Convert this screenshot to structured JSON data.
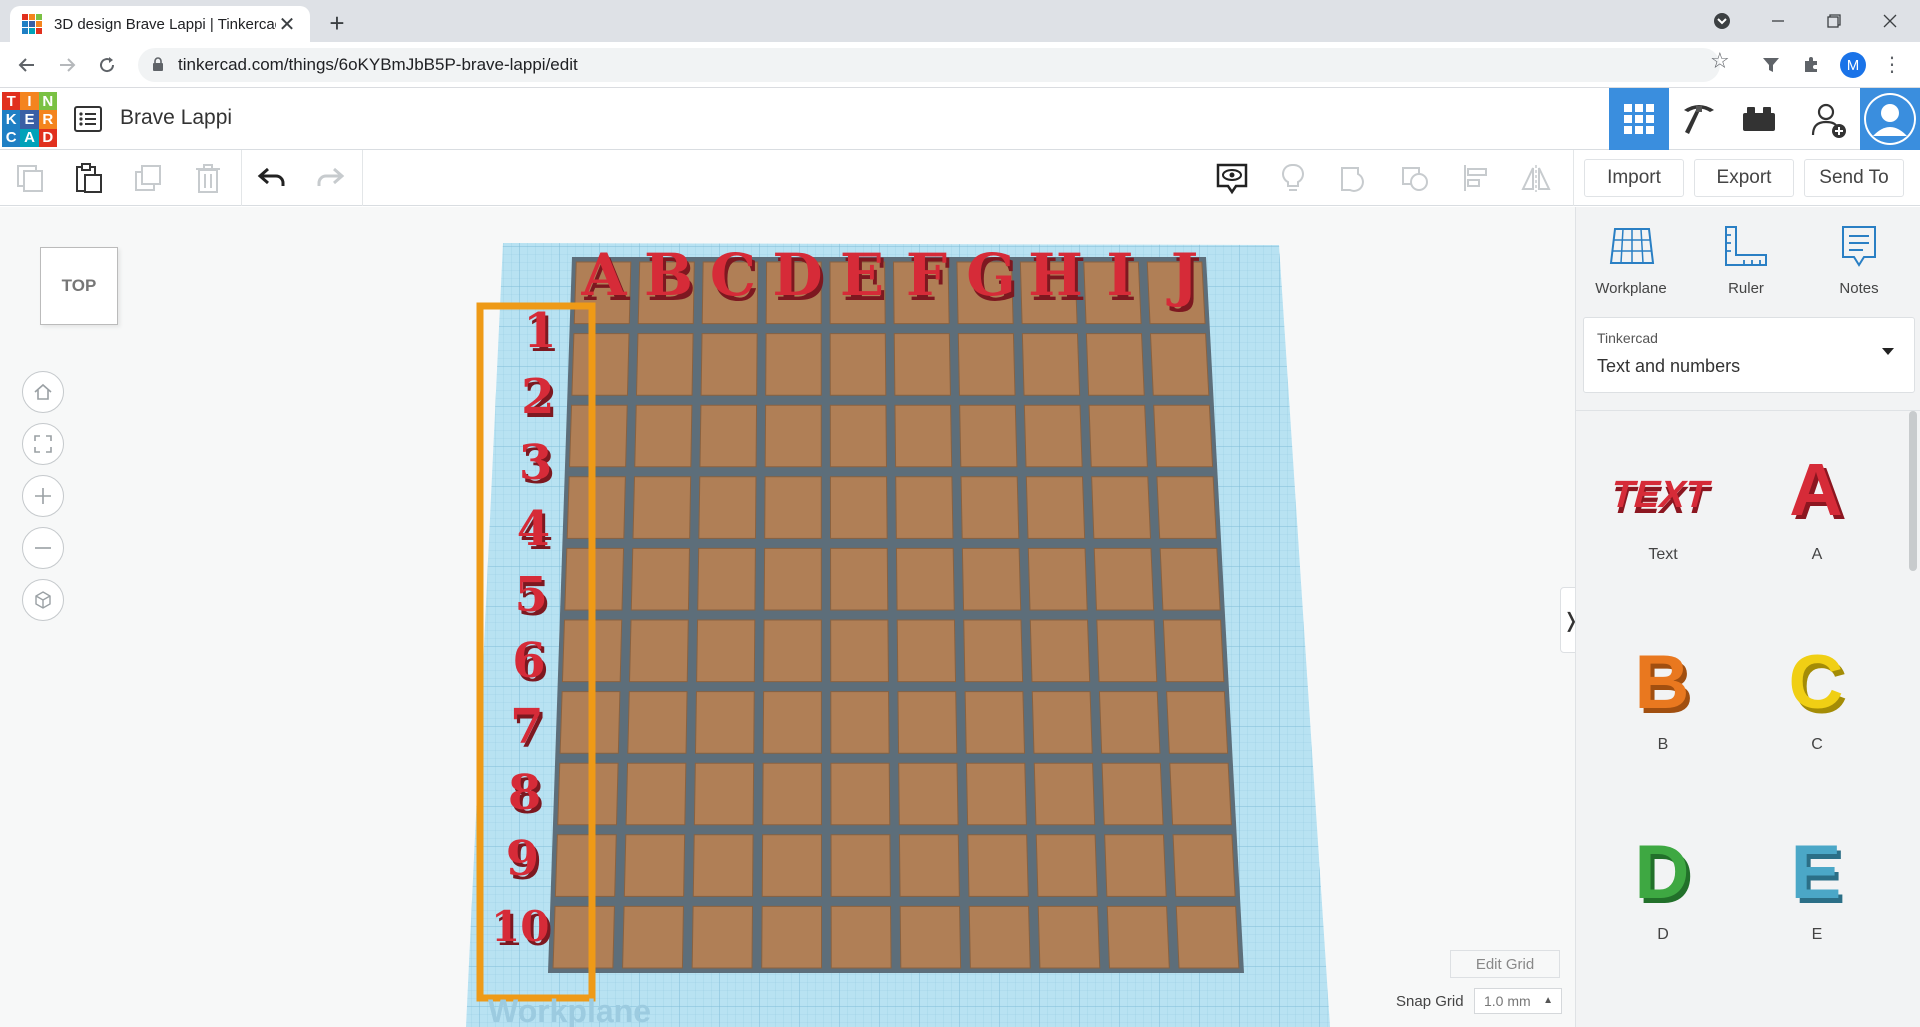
{
  "browser": {
    "tab_title": "3D design Brave Lappi | Tinkercad",
    "tab_close": "✕",
    "new_tab": "+",
    "url": "tinkercad.com/things/6oKYBmJbB5P-brave-lappi/edit",
    "profile_initial": "M"
  },
  "header": {
    "logo_letters": [
      "T",
      "I",
      "N",
      "K",
      "E",
      "R",
      "C",
      "A",
      "D"
    ],
    "logo_colors": [
      "#e1301e",
      "#f4841e",
      "#7ac143",
      "#1f7fc4",
      "#3a5fa5",
      "#f4841e",
      "#1f7fc4",
      "#00a2b9",
      "#e1301e"
    ],
    "design_title": "Brave Lappi"
  },
  "toolbar": {
    "import_label": "Import",
    "export_label": "Export",
    "sendto_label": "Send To"
  },
  "viewport": {
    "viewcube_label": "TOP",
    "workplane_watermark": "Workplane",
    "column_letters": [
      "A",
      "B",
      "C",
      "D",
      "E",
      "F",
      "G",
      "H",
      "I",
      "J"
    ],
    "row_numbers": [
      "1",
      "2",
      "3",
      "4",
      "5",
      "6",
      "7",
      "8",
      "9",
      "10"
    ],
    "edit_grid_label": "Edit Grid",
    "snap_grid_label": "Snap Grid",
    "snap_grid_value": "1.0 mm"
  },
  "panel": {
    "tools": [
      {
        "label": "Workplane",
        "icon": "workplane-icon"
      },
      {
        "label": "Ruler",
        "icon": "ruler-icon"
      },
      {
        "label": "Notes",
        "icon": "notes-icon"
      }
    ],
    "library_source": "Tinkercad",
    "library_name": "Text and numbers",
    "shapes": [
      {
        "label": "Text",
        "color": "#d62b38"
      },
      {
        "label": "A",
        "color": "#d62b38"
      },
      {
        "label": "B",
        "color": "#e9781f"
      },
      {
        "label": "C",
        "color": "#f0cf14"
      },
      {
        "label": "D",
        "color": "#3ea842"
      },
      {
        "label": "E",
        "color": "#4ba7c7"
      }
    ]
  },
  "colors": {
    "accent_blue": "#3a8ede",
    "selection_orange": "#ee9a17",
    "board_brown": "#b07f56",
    "letter_red": "#d62b38",
    "workplane_blue": "#b8e2f2"
  }
}
